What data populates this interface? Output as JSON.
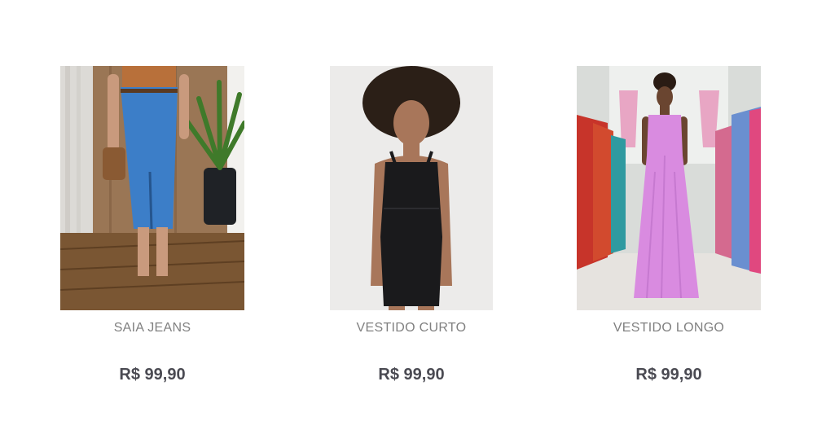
{
  "products": [
    {
      "name": "SAIA JEANS",
      "price": "R$ 99,90",
      "image": "product-photo-denim-skirt"
    },
    {
      "name": "VESTIDO CURTO",
      "price": "R$ 99,90",
      "image": "product-photo-black-short-dress"
    },
    {
      "name": "VESTIDO LONGO",
      "price": "R$ 99,90",
      "image": "product-photo-pink-long-dress"
    }
  ]
}
